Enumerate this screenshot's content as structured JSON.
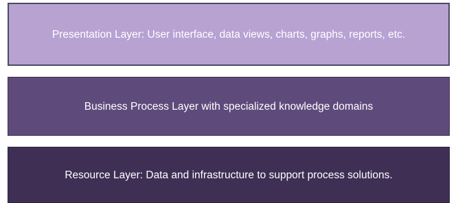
{
  "layers": [
    {
      "name": "presentation",
      "text": "Presentation Layer: User interface, data views, charts, graphs, reports, etc.",
      "color": "#b7a2d2"
    },
    {
      "name": "business",
      "text": "Business Process Layer with specialized knowledge domains",
      "color": "#5f4a7c"
    },
    {
      "name": "resource",
      "text": "Resource Layer: Data and infrastructure to support process solutions.",
      "color": "#3f2f55"
    }
  ]
}
